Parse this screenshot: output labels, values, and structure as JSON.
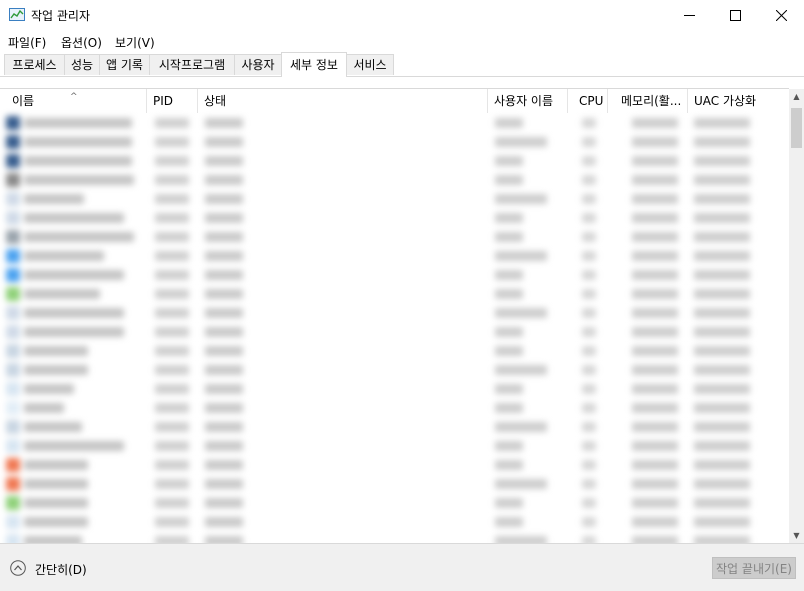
{
  "window": {
    "title": "작업 관리자"
  },
  "menu": [
    "파일(F)",
    "옵션(O)",
    "보기(V)"
  ],
  "tabs": [
    {
      "label": "프로세스"
    },
    {
      "label": "성능"
    },
    {
      "label": "앱 기록"
    },
    {
      "label": "시작프로그램"
    },
    {
      "label": "사용자"
    },
    {
      "label": "세부 정보",
      "active": true
    },
    {
      "label": "서비스"
    }
  ],
  "columns": [
    "이름",
    "PID",
    "상태",
    "사용자 이름",
    "CPU",
    "메모리(활...",
    "UAC 가상화"
  ],
  "footer": {
    "collapse_label": "간단히(D)",
    "end_task_label": "작업 끝내기(E)"
  },
  "colors": {
    "accent": "#0078d7",
    "border": "#d9d9d9",
    "disabled_button": "#cccccc"
  },
  "icons": [
    "task-manager-icon",
    "minimize-icon",
    "maximize-icon",
    "close-icon",
    "sort-up-icon",
    "chevron-up-icon"
  ]
}
